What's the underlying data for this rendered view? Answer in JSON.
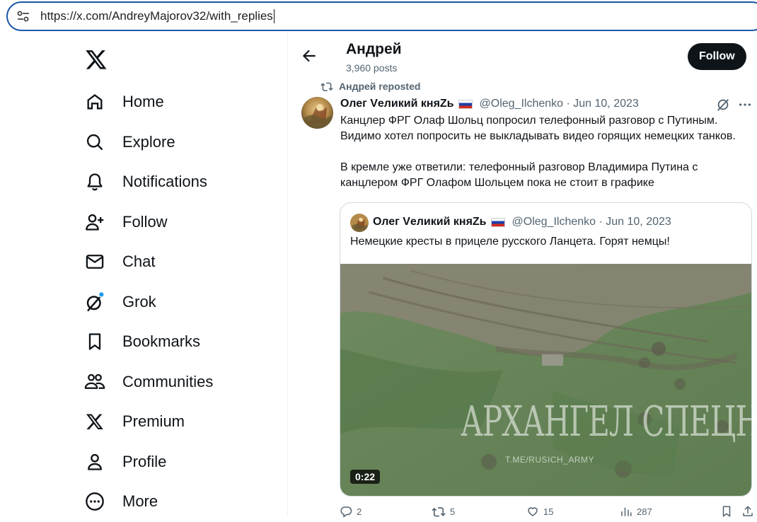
{
  "browser": {
    "url": "https://x.com/AndreyMajorov32/with_replies"
  },
  "sidebar": {
    "logo_icon": "x-logo-icon",
    "items": [
      {
        "label": "Home",
        "icon": "home-icon"
      },
      {
        "label": "Explore",
        "icon": "search-icon"
      },
      {
        "label": "Notifications",
        "icon": "bell-icon"
      },
      {
        "label": "Follow",
        "icon": "person-add-icon"
      },
      {
        "label": "Chat",
        "icon": "mail-icon"
      },
      {
        "label": "Grok",
        "icon": "grok-icon"
      },
      {
        "label": "Bookmarks",
        "icon": "bookmark-icon"
      },
      {
        "label": "Communities",
        "icon": "communities-icon"
      },
      {
        "label": "Premium",
        "icon": "x-premium-icon"
      },
      {
        "label": "Profile",
        "icon": "person-icon"
      },
      {
        "label": "More",
        "icon": "more-circle-icon"
      }
    ]
  },
  "header": {
    "name": "Андрей",
    "posts": "3,960 posts",
    "follow_label": "Follow"
  },
  "tweet": {
    "repost_label": "Андрей reposted",
    "author_name": "Олег Vеликий княZь",
    "author_meta": "@Oleg_Ilchenko · Jun 10, 2023",
    "text_line1": "Канцлер ФРГ Олаф Шольц попросил телефонный разговор с Путиным.",
    "text_line2": "Видимо хотел попросить не выкладывать видео горящих немецких танков.",
    "text_line3": "В кремле уже ответили: телефонный разговор Владимира Путина с",
    "text_line4": "канцлером ФРГ Олафом Шольцем пока не стоит в графике",
    "quote": {
      "author_name": "Олег Vеликий княZь",
      "author_meta": "@Oleg_Ilchenko · Jun 10, 2023",
      "text": "Немецкие кресты в прицеле русского Ланцета. Горят немцы!",
      "duration": "0:22",
      "watermark": "АРХАНГЕЛ СПЕЦНАЗА",
      "watermark_sub": "T.ME/RUSICH_ARMY"
    },
    "actions": {
      "replies": "2",
      "reposts": "5",
      "likes": "15",
      "views": "287"
    }
  },
  "colors": {
    "accent": "#1d9bf0",
    "text_primary": "#0f1419",
    "text_secondary": "#536471",
    "border": "#cfd9de"
  }
}
